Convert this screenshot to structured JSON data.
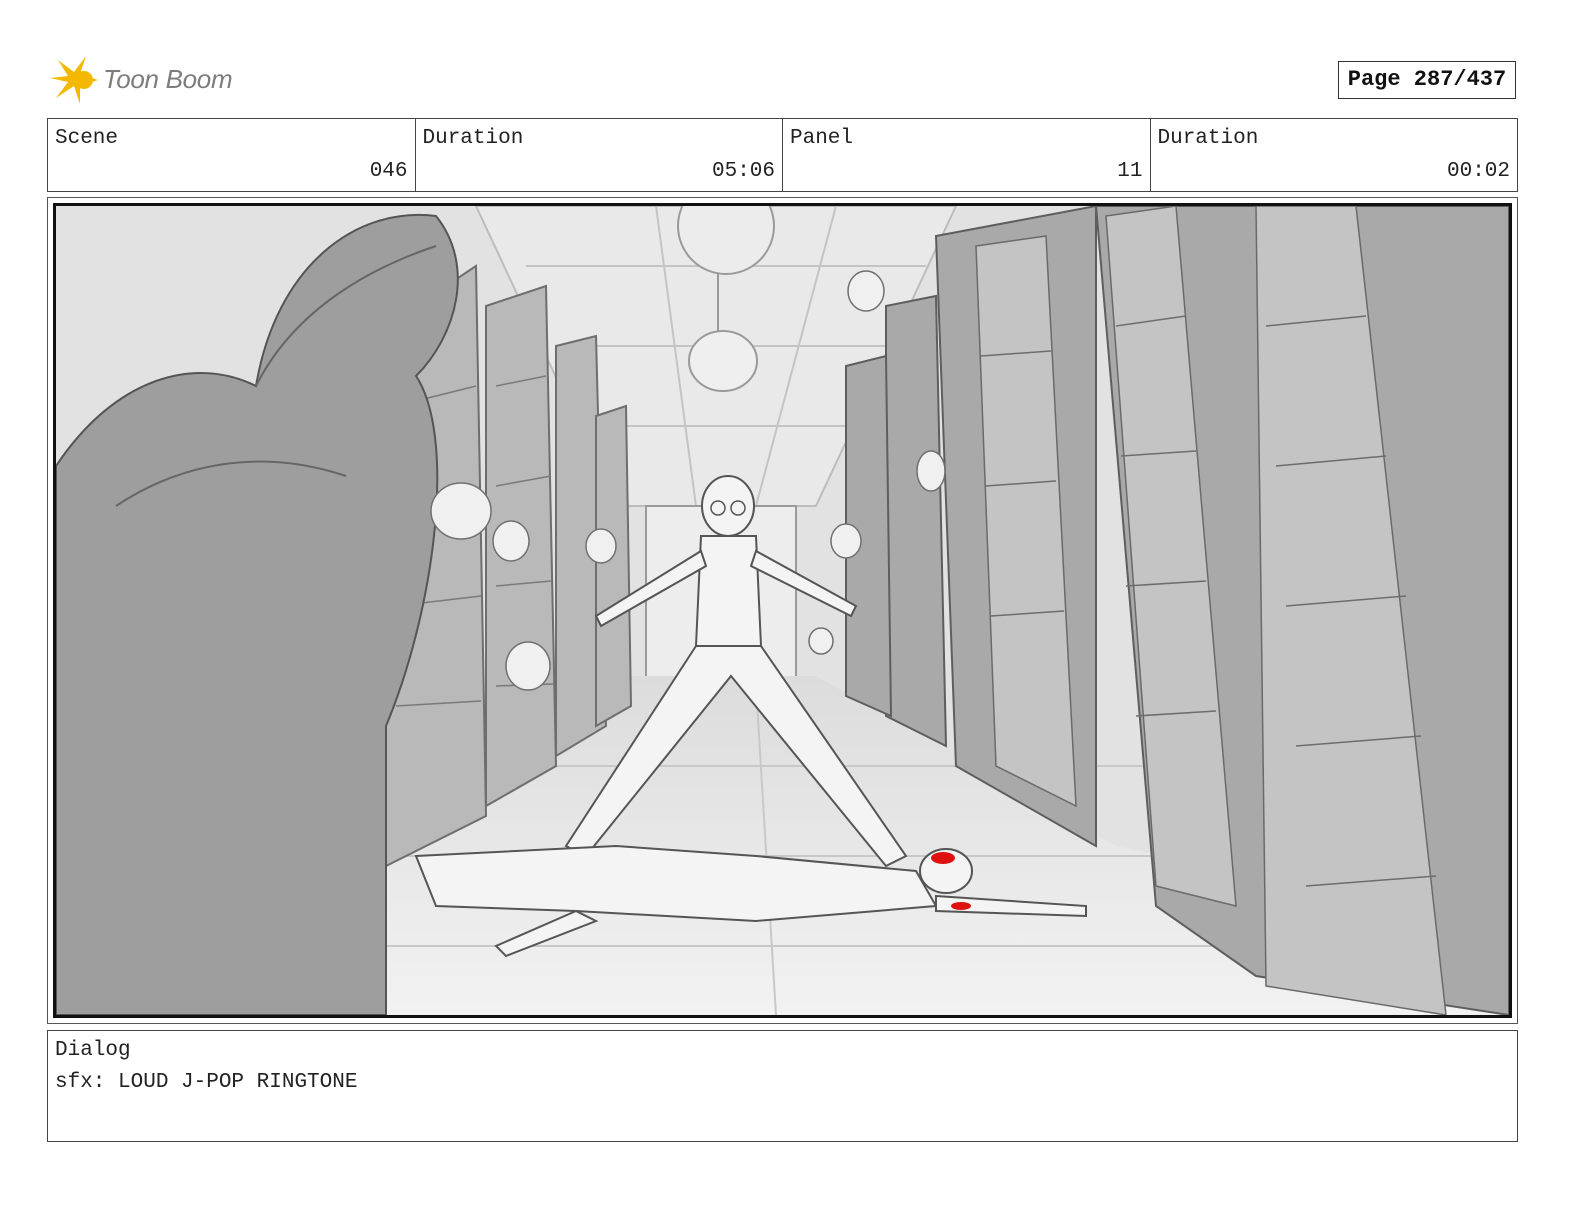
{
  "header": {
    "logo_text": "Toon Boom",
    "page_label": "Page 287/437"
  },
  "info": {
    "scene_label": "Scene",
    "scene_value": "046",
    "scene_duration_label": "Duration",
    "scene_duration_value": "05:06",
    "panel_label": "Panel",
    "panel_value": "11",
    "panel_duration_label": "Duration",
    "panel_duration_value": "00:02"
  },
  "frame": {
    "description_icon": "storyboard-panel-image",
    "border_color": "#2e7d32"
  },
  "dialog": {
    "label": "Dialog",
    "text": "sfx: LOUD J-POP RINGTONE"
  },
  "colors": {
    "logo_yellow": "#f5b800",
    "logo_text": "#7d7d7d",
    "blood_red": "#e01010"
  }
}
